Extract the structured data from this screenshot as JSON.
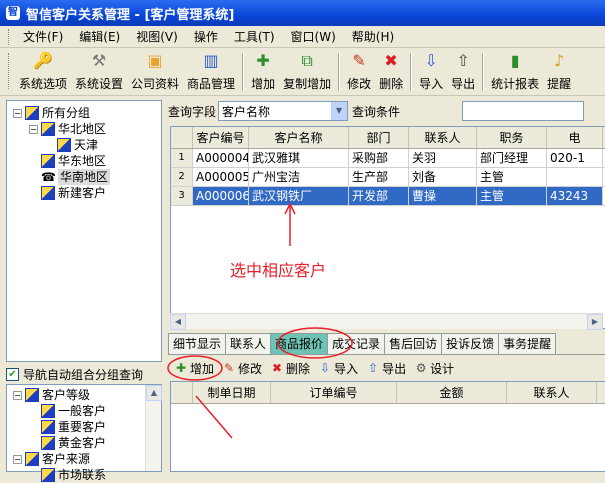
{
  "window": {
    "title": "智信客户关系管理 - [客户管理系统]"
  },
  "menu": [
    "文件(F)",
    "编辑(E)",
    "视图(V)",
    "操作",
    "工具(T)",
    "窗口(W)",
    "帮助(H)"
  ],
  "toolbar": [
    {
      "label": "系统选项",
      "icon": "key-icon",
      "color": "#d9a21b"
    },
    {
      "label": "系统设置",
      "icon": "tools-icon",
      "color": "#7a7a7a"
    },
    {
      "label": "公司资料",
      "icon": "card-icon",
      "color": "#e8a22a"
    },
    {
      "label": "商品管理",
      "icon": "box-icon",
      "color": "#2a5fd0"
    },
    {
      "label": "增加",
      "icon": "add-user-icon",
      "color": "#2a8f2a"
    },
    {
      "label": "复制增加",
      "icon": "copy-add-icon",
      "color": "#2a8f2a"
    },
    {
      "label": "修改",
      "icon": "pencil-icon",
      "color": "#c23b22"
    },
    {
      "label": "删除",
      "icon": "delete-icon",
      "color": "#d81e1e"
    },
    {
      "label": "导入",
      "icon": "import-icon",
      "color": "#2a5fd0"
    },
    {
      "label": "导出",
      "icon": "export-icon",
      "color": "#4a4a4a"
    },
    {
      "label": "统计报表",
      "icon": "chart-icon",
      "color": "#2a8f2a"
    },
    {
      "label": "提醒",
      "icon": "bell-icon",
      "color": "#d9a21b"
    }
  ],
  "tree_groups": [
    {
      "label": "所有分组",
      "indent": 0,
      "exp": "-",
      "icon": "folder"
    },
    {
      "label": "华北地区",
      "indent": 1,
      "exp": "-",
      "icon": "folder"
    },
    {
      "label": "天津",
      "indent": 2,
      "exp": "",
      "icon": "folder"
    },
    {
      "label": "华东地区",
      "indent": 1,
      "exp": "",
      "icon": "folder"
    },
    {
      "label": "华南地区",
      "indent": 1,
      "exp": "",
      "icon": "phone",
      "selected": true
    },
    {
      "label": "新建客户",
      "indent": 1,
      "exp": "",
      "icon": "folder"
    }
  ],
  "nav_checkbox": {
    "label": "导航自动组合分组查询",
    "checked": true
  },
  "tree_nav": [
    {
      "label": "客户等级",
      "indent": 0,
      "exp": "-"
    },
    {
      "label": "一般客户",
      "indent": 1,
      "exp": ""
    },
    {
      "label": "重要客户",
      "indent": 1,
      "exp": ""
    },
    {
      "label": "黄金客户",
      "indent": 1,
      "exp": ""
    },
    {
      "label": "客户来源",
      "indent": 0,
      "exp": "-"
    },
    {
      "label": "市场联系",
      "indent": 1,
      "exp": ""
    }
  ],
  "query": {
    "field_label": "查询字段",
    "field_value": "客户名称",
    "condition_label": "查询条件",
    "condition_value": ""
  },
  "grid": {
    "columns": [
      "客户编号",
      "客户名称",
      "部门",
      "联系人",
      "职务",
      "电"
    ],
    "rows": [
      {
        "n": "1",
        "cells": [
          "A000004",
          "武汉雅琪",
          "采购部",
          "关羽",
          "部门经理",
          "020-1"
        ]
      },
      {
        "n": "2",
        "cells": [
          "A000005",
          "广州宝洁",
          "生产部",
          "刘备",
          "主管",
          ""
        ]
      },
      {
        "n": "3",
        "cells": [
          "A000006",
          "武汉钢铁厂",
          "开发部",
          "曹操",
          "主管",
          "43243"
        ],
        "selected": true
      }
    ]
  },
  "annotation": "选中相应客户",
  "tabs": [
    "细节显示",
    "联系人",
    "商品报价",
    "成交记录",
    "售后回访",
    "投诉反馈",
    "事务提醒"
  ],
  "active_tab": 2,
  "subtoolbar": [
    {
      "label": "增加",
      "icon": "add-icon",
      "color": "#2a8f2a"
    },
    {
      "label": "修改",
      "icon": "edit-icon",
      "color": "#c23b22"
    },
    {
      "label": "删除",
      "icon": "delete-icon",
      "color": "#d81e1e"
    },
    {
      "label": "导入",
      "icon": "import-icon",
      "color": "#2a5fd0"
    },
    {
      "label": "导出",
      "icon": "export-icon",
      "color": "#2a5fd0"
    },
    {
      "label": "设计",
      "icon": "design-icon",
      "color": "#555555"
    }
  ],
  "detail_grid": {
    "columns": [
      "制单日期",
      "订单编号",
      "金额",
      "联系人"
    ]
  },
  "colors": {
    "title": "#0a45d8",
    "selection": "#316ac5",
    "annotation": "#e8202a",
    "active_tab": "#6ec4b4"
  }
}
